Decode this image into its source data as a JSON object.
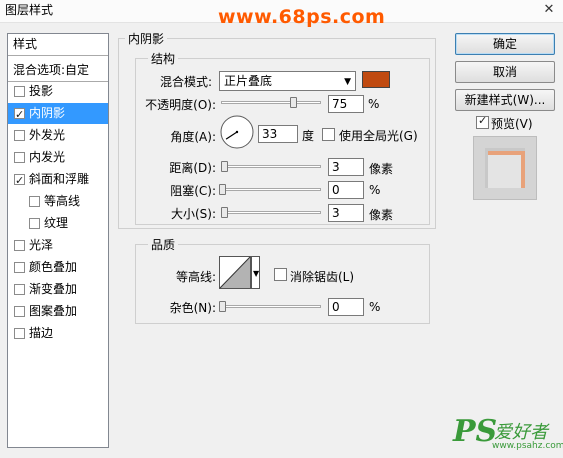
{
  "window": {
    "title": "图层样式",
    "close_glyph": "✕"
  },
  "watermark": "www.68ps.com",
  "style_list": {
    "header": "样式",
    "blend_options": "混合选项:自定",
    "items": [
      {
        "label": "投影",
        "checked": false,
        "selected": false,
        "indent": false
      },
      {
        "label": "内阴影",
        "checked": true,
        "selected": true,
        "indent": false
      },
      {
        "label": "外发光",
        "checked": false,
        "selected": false,
        "indent": false
      },
      {
        "label": "内发光",
        "checked": false,
        "selected": false,
        "indent": false
      },
      {
        "label": "斜面和浮雕",
        "checked": true,
        "selected": false,
        "indent": false
      },
      {
        "label": "等高线",
        "checked": false,
        "selected": false,
        "indent": true
      },
      {
        "label": "纹理",
        "checked": false,
        "selected": false,
        "indent": true
      },
      {
        "label": "光泽",
        "checked": false,
        "selected": false,
        "indent": false
      },
      {
        "label": "颜色叠加",
        "checked": false,
        "selected": false,
        "indent": false
      },
      {
        "label": "渐变叠加",
        "checked": false,
        "selected": false,
        "indent": false
      },
      {
        "label": "图案叠加",
        "checked": false,
        "selected": false,
        "indent": false
      },
      {
        "label": "描边",
        "checked": false,
        "selected": false,
        "indent": false
      }
    ]
  },
  "panel": {
    "title": "内阴影",
    "structure": {
      "title": "结构",
      "blend_mode_label": "混合模式:",
      "blend_mode_value": "正片叠底",
      "color": "#c04a10",
      "opacity_label": "不透明度(O):",
      "opacity_value": "75",
      "opacity_unit": "%",
      "opacity_fraction": 0.75,
      "angle_label": "角度(A):",
      "angle_value": "33",
      "angle_unit": "度",
      "global_light_label": "使用全局光(G)",
      "global_light_checked": false,
      "distance_label": "距离(D):",
      "distance_value": "3",
      "distance_unit": "像素",
      "choke_label": "阻塞(C):",
      "choke_value": "0",
      "choke_unit": "%",
      "size_label": "大小(S):",
      "size_value": "3",
      "size_unit": "像素"
    },
    "quality": {
      "title": "品质",
      "contour_label": "等高线:",
      "antialias_label": "消除锯齿(L)",
      "antialias_checked": false,
      "noise_label": "杂色(N):",
      "noise_value": "0",
      "noise_unit": "%"
    }
  },
  "buttons": {
    "ok": "确定",
    "cancel": "取消",
    "new_style": "新建样式(W)...",
    "preview_label": "预览(V)",
    "preview_checked": true
  },
  "logo": {
    "ps": "PS",
    "text": "爱好者",
    "url": "www.psahz.com"
  }
}
